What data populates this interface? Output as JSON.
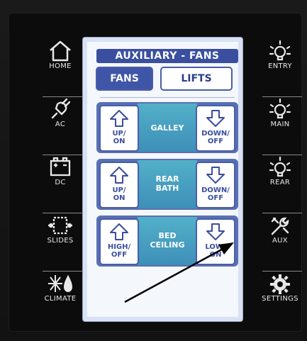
{
  "nav_left": [
    {
      "label": "HOME",
      "icon": "home-icon"
    },
    {
      "label": "AC",
      "icon": "plug-icon"
    },
    {
      "label": "DC",
      "icon": "battery-icon"
    },
    {
      "label": "SLIDES",
      "icon": "slide-out-icon"
    },
    {
      "label": "CLIMATE",
      "icon": "climate-icon"
    }
  ],
  "nav_right": [
    {
      "label": "ENTRY",
      "icon": "light-bulb-icon"
    },
    {
      "label": "MAIN",
      "icon": "light-bulb-icon"
    },
    {
      "label": "REAR",
      "icon": "light-bulb-icon"
    },
    {
      "label": "AUX",
      "icon": "tools-icon"
    },
    {
      "label": "SETTINGS",
      "icon": "gear-icon"
    }
  ],
  "screen": {
    "title": "AUXILIARY - FANS",
    "tabs": {
      "fans": "FANS",
      "lifts": "LIFTS"
    },
    "rows": [
      {
        "name": "GALLEY",
        "left_line1": "UP/",
        "left_line2": "ON",
        "right_line1": "DOWN/",
        "right_line2": "OFF"
      },
      {
        "name_line1": "REAR",
        "name_line2": "BATH",
        "left_line1": "UP/",
        "left_line2": "ON",
        "right_line1": "DOWN/",
        "right_line2": "OFF"
      },
      {
        "name_line1": "BED",
        "name_line2": "CEILING",
        "left_line1": "HIGH/",
        "left_line2": "OFF",
        "right_line1": "LOW/",
        "right_line2": "ON"
      }
    ]
  },
  "colors": {
    "accent": "#3f55a8",
    "row_mid": "#4aa3c2",
    "screen_bg": "#f4f7fb",
    "bezel": "#0c0c0c"
  }
}
